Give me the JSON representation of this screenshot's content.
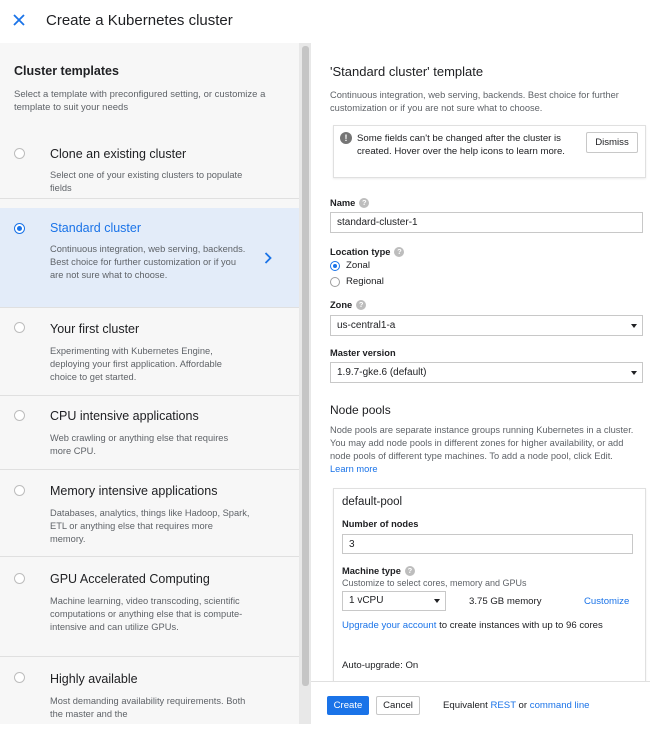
{
  "topbar": {
    "title": "Create a Kubernetes cluster"
  },
  "left": {
    "title": "Cluster templates",
    "subtitle": "Select a template with preconfigured setting, or customize a template to suit your needs",
    "templates": [
      {
        "title": "Clone an existing cluster",
        "desc": "Select one of your existing clusters to populate fields",
        "selected": false
      },
      {
        "title": "Standard cluster",
        "desc": "Continuous integration, web serving, backends. Best choice for further customization or if you are not sure what to choose.",
        "selected": true
      },
      {
        "title": "Your first cluster",
        "desc": "Experimenting with Kubernetes Engine, deploying your first application. Affordable choice to get started.",
        "selected": false
      },
      {
        "title": "CPU intensive applications",
        "desc": "Web crawling or anything else that requires more CPU.",
        "selected": false
      },
      {
        "title": "Memory intensive applications",
        "desc": "Databases, analytics, things like Hadoop, Spark, ETL or anything else that requires more memory.",
        "selected": false
      },
      {
        "title": "GPU Accelerated Computing",
        "desc": "Machine learning, video transcoding, scientific computations or anything else that is compute-intensive and can utilize GPUs.",
        "selected": false
      },
      {
        "title": "Highly available",
        "desc": "Most demanding availability requirements. Both the master and the",
        "selected": false
      }
    ]
  },
  "right": {
    "title": "'Standard cluster' template",
    "subtitle": "Continuous integration, web serving, backends. Best choice for further customization or if you are not sure what to choose.",
    "notice": {
      "text": "Some fields can't be changed after the cluster is created. Hover over the help icons to learn more.",
      "dismiss": "Dismiss"
    },
    "name": {
      "label": "Name",
      "value": "standard-cluster-1"
    },
    "location_type": {
      "label": "Location type",
      "options": [
        "Zonal",
        "Regional"
      ],
      "selected": "Zonal"
    },
    "zone": {
      "label": "Zone",
      "value": "us-central1-a"
    },
    "master_version": {
      "label": "Master version",
      "value": "1.9.7-gke.6 (default)"
    },
    "node_pools": {
      "title": "Node pools",
      "desc": "Node pools are separate instance groups running Kubernetes in a cluster. You may add node pools in different zones for higher availability, or add node pools of different type machines. To add a node pool, click Edit.",
      "learn_more": "Learn more"
    },
    "pool": {
      "title": "default-pool",
      "nodes_label": "Number of nodes",
      "nodes_value": "3",
      "machine_label": "Machine type",
      "machine_sub": "Customize to select cores, memory and GPUs",
      "machine_value": "1 vCPU",
      "memory": "3.75 GB memory",
      "customize": "Customize",
      "upgrade_link": "Upgrade your account",
      "upgrade_text": " to create instances with up to 96 cores",
      "auto_upgrade": "Auto-upgrade: On"
    }
  },
  "footer": {
    "create": "Create",
    "cancel": "Cancel",
    "equiv_prefix": "Equivalent ",
    "rest": "REST",
    "or": " or ",
    "command_line": "command line"
  },
  "colors": {
    "accent": "#1a73e8",
    "selected_bg": "#e3ecf9",
    "left_bg": "#f7f7f7"
  }
}
